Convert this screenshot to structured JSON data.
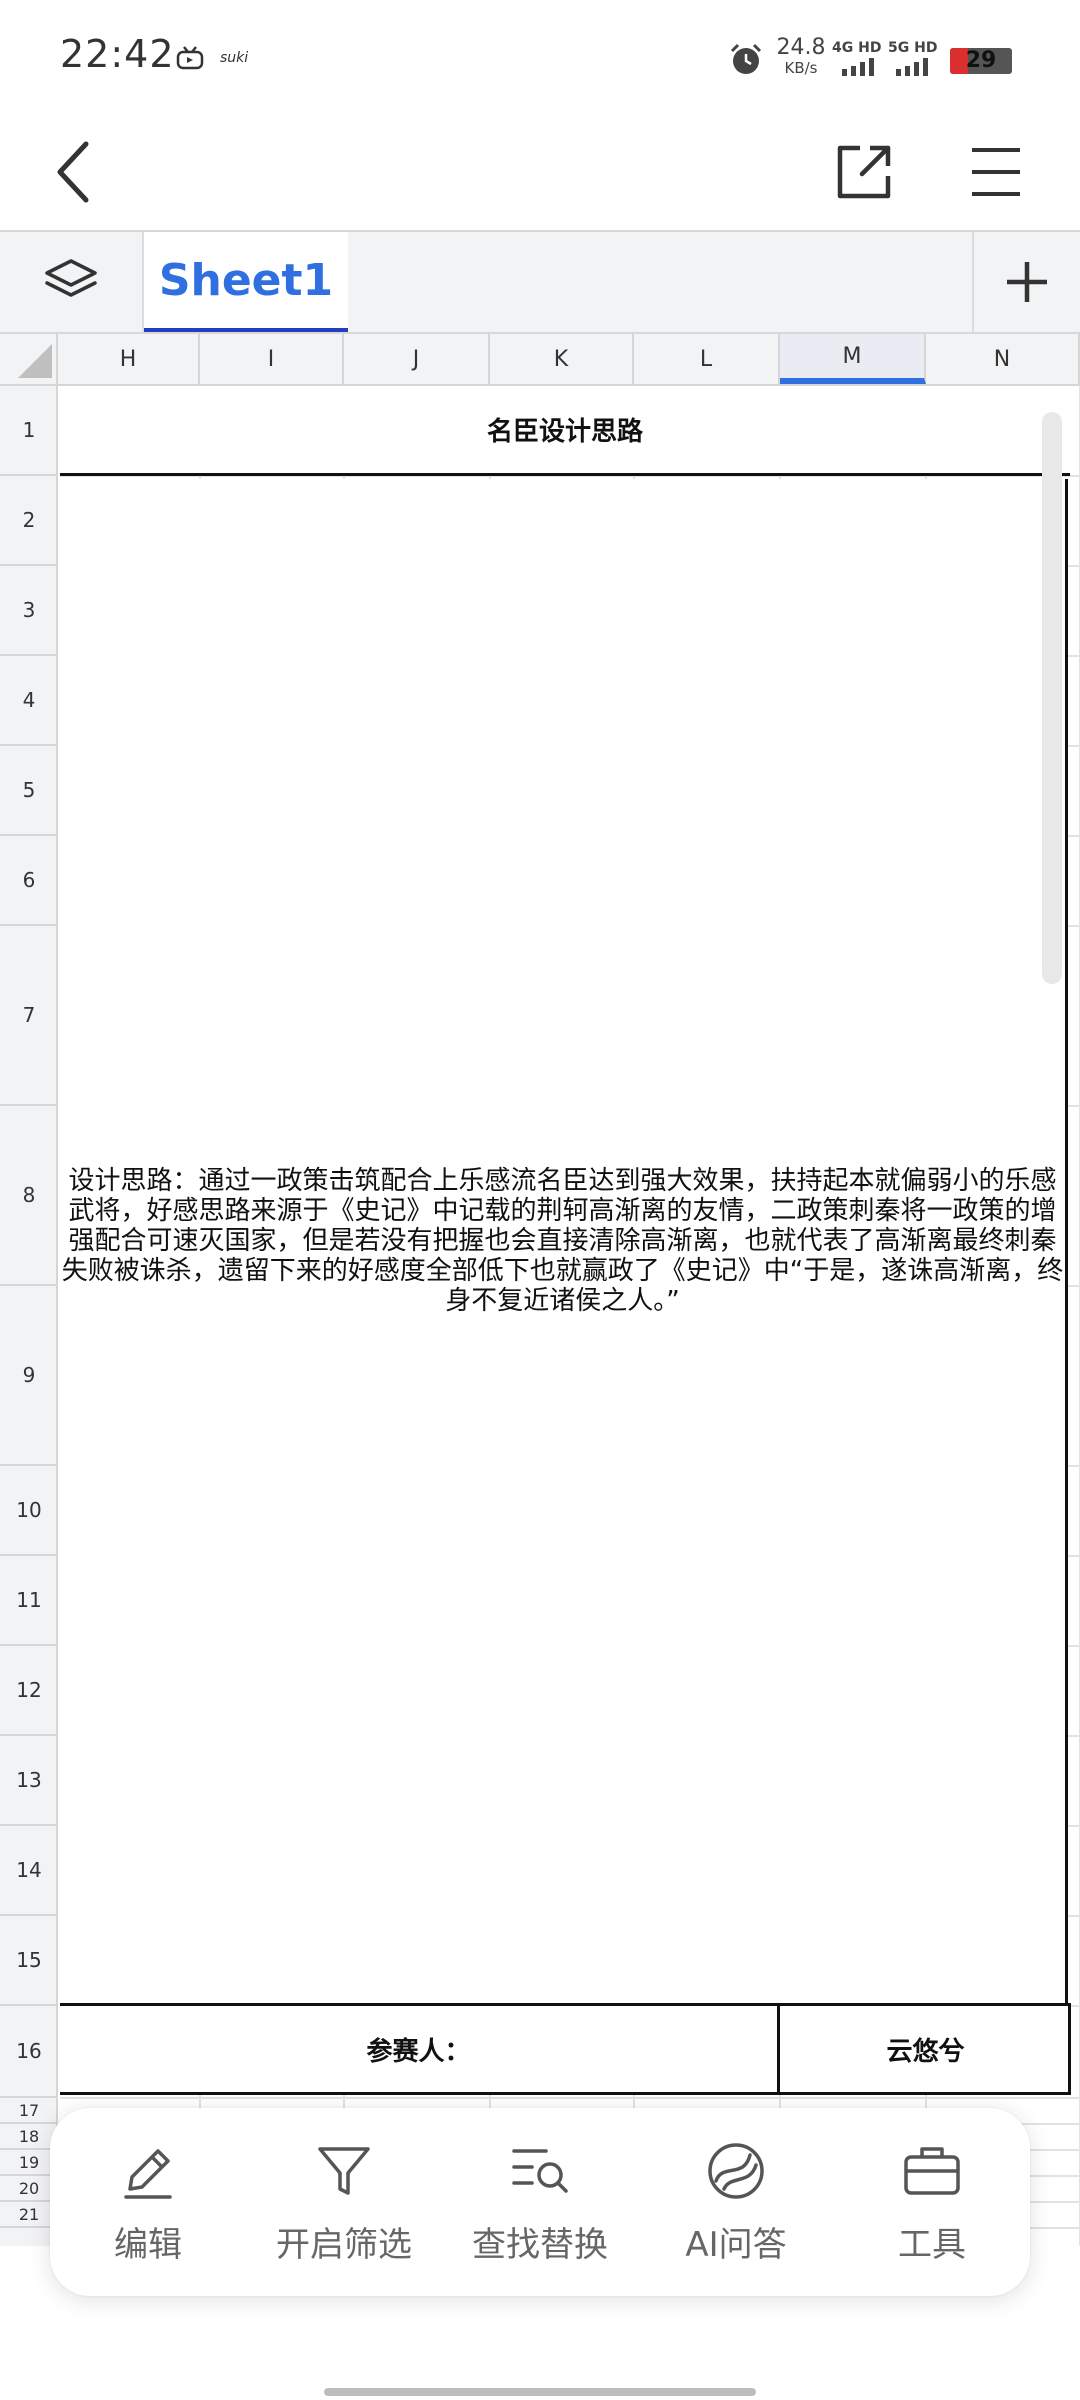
{
  "status": {
    "time": "22:42",
    "carrier_tag": "suki",
    "speed_value": "24.8",
    "speed_unit": "KB/s",
    "net1": "4G HD",
    "net2": "5G HD",
    "battery": "29",
    "battery_level": 0.29
  },
  "tabs": {
    "sheet": "Sheet1"
  },
  "columns": [
    "H",
    "I",
    "J",
    "K",
    "L",
    "M",
    "N"
  ],
  "active_column": "M",
  "rows": [
    "1",
    "2",
    "3",
    "4",
    "5",
    "6",
    "7",
    "8",
    "9",
    "10",
    "11",
    "12",
    "13",
    "14",
    "15",
    "16",
    "17",
    "18",
    "19",
    "20",
    "21"
  ],
  "sheet": {
    "title": "名臣设计思路",
    "body": "设计思路：通过一政策击筑配合上乐感流名臣达到强大效果，扶持起本就偏弱小的乐感武将，好感思路来源于《史记》中记载的荆轲高渐离的友情，二政策刺秦将一政策的增强配合可速灭国家，但是若没有把握也会直接清除高渐离，也就代表了高渐离最终刺秦失败被诛杀，遗留下来的好感度全部低下也就赢政了《史记》中“于是，遂诛高渐离，终身不复近诸侯之人。”",
    "footer_label": "参赛人：",
    "footer_name": "云悠兮"
  },
  "toolbar": {
    "edit": "编辑",
    "filter": "开启筛选",
    "find_replace": "查找替换",
    "ai_qa": "AI问答",
    "tools": "工具"
  },
  "colors": {
    "accent": "#2f6fe0",
    "tab_underline": "#1f3fbf",
    "battery_low": "#d9302f"
  }
}
